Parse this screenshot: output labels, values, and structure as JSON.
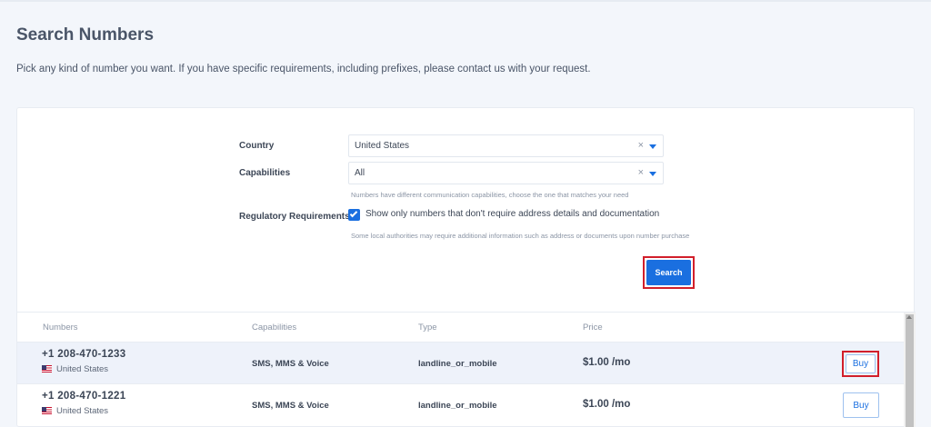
{
  "header": {
    "title": "Search Numbers",
    "description": "Pick any kind of number you want. If you have specific requirements, including prefixes, please contact us with your request."
  },
  "form": {
    "country": {
      "label": "Country",
      "value": "United States",
      "clear": "×"
    },
    "capabilities": {
      "label": "Capabilities",
      "value": "All",
      "clear": "×",
      "hint": "Numbers have different communication capabilities, choose the one that matches your need"
    },
    "regulatory": {
      "label": "Regulatory Requirements",
      "checkbox_label": "Show only numbers that don't require address details and documentation",
      "checked": true,
      "hint": "Some local authorities may require additional information such as address or documents upon number purchase"
    },
    "search_label": "Search"
  },
  "table": {
    "columns": [
      "Numbers",
      "Capabilities",
      "Type",
      "Price"
    ],
    "rows": [
      {
        "number": "+1 208-470-1233",
        "country": "United States",
        "capabilities": "SMS, MMS & Voice",
        "type": "landline_or_mobile",
        "price": "$1.00 /mo",
        "buy_label": "Buy"
      },
      {
        "number": "+1 208-470-1221",
        "country": "United States",
        "capabilities": "SMS, MMS & Voice",
        "type": "landline_or_mobile",
        "price": "$1.00 /mo",
        "buy_label": "Buy"
      }
    ]
  },
  "colors": {
    "accent": "#1a6fe0",
    "highlight": "#d21f2b",
    "background": "#f3f6fb"
  },
  "icons": {
    "dropdown": "chevron-down-icon",
    "clear": "close-icon",
    "flag": "us-flag-icon",
    "check": "check-icon"
  }
}
